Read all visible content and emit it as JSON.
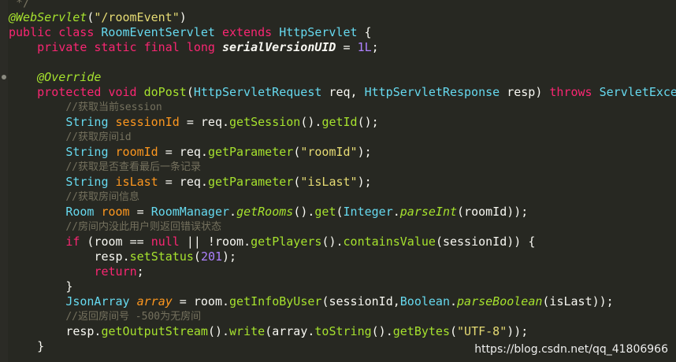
{
  "theme": {
    "background": "#272822",
    "plain": "#f8f8f2",
    "keyword": "#f92672",
    "type": "#66d9ef",
    "string": "#e6db74",
    "number": "#ae81ff",
    "comment": "#75715e",
    "annotation": "#a6e22e",
    "method": "#a6e22e",
    "field": "#fd971f"
  },
  "editor": {
    "fold_markers": [
      "fold-marker"
    ],
    "lines": [
      {
        "indent": 1,
        "tokens": [
          {
            "t": "*/",
            "c": "comment"
          }
        ]
      },
      {
        "indent": 0,
        "tokens": [
          {
            "t": "@WebServlet",
            "c": "annotation",
            "i": true
          },
          {
            "t": "(",
            "c": "plain"
          },
          {
            "t": "\"/roomEvent\"",
            "c": "string"
          },
          {
            "t": ")",
            "c": "plain"
          }
        ]
      },
      {
        "indent": 0,
        "tokens": [
          {
            "t": "public",
            "c": "keyword"
          },
          {
            "t": " ",
            "c": "plain"
          },
          {
            "t": "class",
            "c": "keyword"
          },
          {
            "t": " ",
            "c": "plain"
          },
          {
            "t": "RoomEventServlet",
            "c": "type"
          },
          {
            "t": " ",
            "c": "plain"
          },
          {
            "t": "extends",
            "c": "keyword"
          },
          {
            "t": " ",
            "c": "plain"
          },
          {
            "t": "HttpServlet",
            "c": "type"
          },
          {
            "t": " {",
            "c": "plain"
          }
        ]
      },
      {
        "indent": 4,
        "tokens": [
          {
            "t": "private",
            "c": "keyword"
          },
          {
            "t": " ",
            "c": "plain"
          },
          {
            "t": "static",
            "c": "keyword"
          },
          {
            "t": " ",
            "c": "plain"
          },
          {
            "t": "final",
            "c": "keyword"
          },
          {
            "t": " ",
            "c": "plain"
          },
          {
            "t": "long",
            "c": "keyword"
          },
          {
            "t": " ",
            "c": "plain"
          },
          {
            "t": "serialVersionUID",
            "c": "plain",
            "i": true,
            "b": true
          },
          {
            "t": " = ",
            "c": "plain"
          },
          {
            "t": "1L",
            "c": "number"
          },
          {
            "t": ";",
            "c": "plain"
          }
        ]
      },
      {
        "indent": 0,
        "tokens": []
      },
      {
        "indent": 4,
        "fold": true,
        "tokens": [
          {
            "t": "@Override",
            "c": "annotation",
            "i": true
          }
        ]
      },
      {
        "indent": 4,
        "tokens": [
          {
            "t": "protected",
            "c": "keyword"
          },
          {
            "t": " ",
            "c": "plain"
          },
          {
            "t": "void",
            "c": "keyword"
          },
          {
            "t": " ",
            "c": "plain"
          },
          {
            "t": "doPost",
            "c": "method"
          },
          {
            "t": "(",
            "c": "plain"
          },
          {
            "t": "HttpServletRequest",
            "c": "type"
          },
          {
            "t": " req, ",
            "c": "plain"
          },
          {
            "t": "HttpServletResponse",
            "c": "type"
          },
          {
            "t": " resp) ",
            "c": "plain"
          },
          {
            "t": "throws",
            "c": "keyword"
          },
          {
            "t": " ",
            "c": "plain"
          },
          {
            "t": "ServletExce",
            "c": "type"
          }
        ]
      },
      {
        "indent": 8,
        "comment": true,
        "tokens": [
          {
            "t": "//获取当前session",
            "c": "comment"
          }
        ]
      },
      {
        "indent": 8,
        "tokens": [
          {
            "t": "String",
            "c": "type"
          },
          {
            "t": " ",
            "c": "plain"
          },
          {
            "t": "sessionId",
            "c": "field"
          },
          {
            "t": " = req.",
            "c": "plain"
          },
          {
            "t": "getSession",
            "c": "method"
          },
          {
            "t": "().",
            "c": "plain"
          },
          {
            "t": "getId",
            "c": "method"
          },
          {
            "t": "();",
            "c": "plain"
          }
        ]
      },
      {
        "indent": 8,
        "comment": true,
        "tokens": [
          {
            "t": "//获取房间id",
            "c": "comment"
          }
        ]
      },
      {
        "indent": 8,
        "tokens": [
          {
            "t": "String",
            "c": "type"
          },
          {
            "t": " ",
            "c": "plain"
          },
          {
            "t": "roomId",
            "c": "field"
          },
          {
            "t": " = req.",
            "c": "plain"
          },
          {
            "t": "getParameter",
            "c": "method"
          },
          {
            "t": "(",
            "c": "plain"
          },
          {
            "t": "\"roomId\"",
            "c": "string"
          },
          {
            "t": ");",
            "c": "plain"
          }
        ]
      },
      {
        "indent": 8,
        "comment": true,
        "tokens": [
          {
            "t": "//获取是否查看最后一条记录",
            "c": "comment"
          }
        ]
      },
      {
        "indent": 8,
        "tokens": [
          {
            "t": "String",
            "c": "type"
          },
          {
            "t": " ",
            "c": "plain"
          },
          {
            "t": "isLast",
            "c": "field"
          },
          {
            "t": " = req.",
            "c": "plain"
          },
          {
            "t": "getParameter",
            "c": "method"
          },
          {
            "t": "(",
            "c": "plain"
          },
          {
            "t": "\"isLast\"",
            "c": "string"
          },
          {
            "t": ");",
            "c": "plain"
          }
        ]
      },
      {
        "indent": 8,
        "comment": true,
        "tokens": [
          {
            "t": "//获取房间信息",
            "c": "comment"
          }
        ]
      },
      {
        "indent": 8,
        "tokens": [
          {
            "t": "Room",
            "c": "type"
          },
          {
            "t": " ",
            "c": "plain"
          },
          {
            "t": "room",
            "c": "field"
          },
          {
            "t": " = ",
            "c": "plain"
          },
          {
            "t": "RoomManager",
            "c": "type"
          },
          {
            "t": ".",
            "c": "plain"
          },
          {
            "t": "getRooms",
            "c": "method",
            "i": true
          },
          {
            "t": "().",
            "c": "plain"
          },
          {
            "t": "get",
            "c": "method"
          },
          {
            "t": "(",
            "c": "plain"
          },
          {
            "t": "Integer",
            "c": "type"
          },
          {
            "t": ".",
            "c": "plain"
          },
          {
            "t": "parseInt",
            "c": "method",
            "i": true
          },
          {
            "t": "(roomId));",
            "c": "plain"
          }
        ]
      },
      {
        "indent": 8,
        "comment": true,
        "tokens": [
          {
            "t": "//房间内没此用户则返回错误状态",
            "c": "comment"
          }
        ]
      },
      {
        "indent": 8,
        "tokens": [
          {
            "t": "if",
            "c": "keyword"
          },
          {
            "t": " (room == ",
            "c": "plain"
          },
          {
            "t": "null",
            "c": "keyword"
          },
          {
            "t": " || !room.",
            "c": "plain"
          },
          {
            "t": "getPlayers",
            "c": "method"
          },
          {
            "t": "().",
            "c": "plain"
          },
          {
            "t": "containsValue",
            "c": "method"
          },
          {
            "t": "(sessionId)) {",
            "c": "plain"
          }
        ]
      },
      {
        "indent": 12,
        "tokens": [
          {
            "t": "resp.",
            "c": "plain"
          },
          {
            "t": "setStatus",
            "c": "method"
          },
          {
            "t": "(",
            "c": "plain"
          },
          {
            "t": "201",
            "c": "number"
          },
          {
            "t": ");",
            "c": "plain"
          }
        ]
      },
      {
        "indent": 12,
        "tokens": [
          {
            "t": "return",
            "c": "keyword"
          },
          {
            "t": ";",
            "c": "plain"
          }
        ]
      },
      {
        "indent": 8,
        "tokens": [
          {
            "t": "}",
            "c": "plain"
          }
        ]
      },
      {
        "indent": 8,
        "tokens": [
          {
            "t": "JsonArray",
            "c": "type"
          },
          {
            "t": " ",
            "c": "plain"
          },
          {
            "t": "array",
            "c": "field",
            "i": true
          },
          {
            "t": " = room.",
            "c": "plain"
          },
          {
            "t": "getInfoByUser",
            "c": "method"
          },
          {
            "t": "(sessionId,",
            "c": "plain"
          },
          {
            "t": "Boolean",
            "c": "type"
          },
          {
            "t": ".",
            "c": "plain"
          },
          {
            "t": "parseBoolean",
            "c": "method",
            "i": true
          },
          {
            "t": "(isLast));",
            "c": "plain"
          }
        ]
      },
      {
        "indent": 8,
        "comment": true,
        "tokens": [
          {
            "t": "//返回房间号 -500为无房间",
            "c": "comment"
          }
        ]
      },
      {
        "indent": 8,
        "tokens": [
          {
            "t": "resp.",
            "c": "plain"
          },
          {
            "t": "getOutputStream",
            "c": "method"
          },
          {
            "t": "().",
            "c": "plain"
          },
          {
            "t": "write",
            "c": "method"
          },
          {
            "t": "(array.",
            "c": "plain"
          },
          {
            "t": "toString",
            "c": "method"
          },
          {
            "t": "().",
            "c": "plain"
          },
          {
            "t": "getBytes",
            "c": "method"
          },
          {
            "t": "(",
            "c": "plain"
          },
          {
            "t": "\"UTF-8\"",
            "c": "string"
          },
          {
            "t": "));",
            "c": "plain"
          }
        ]
      },
      {
        "indent": 4,
        "tokens": [
          {
            "t": "}",
            "c": "plain"
          }
        ]
      }
    ]
  },
  "watermark": {
    "text": "https://blog.csdn.net/qq_41806966"
  }
}
